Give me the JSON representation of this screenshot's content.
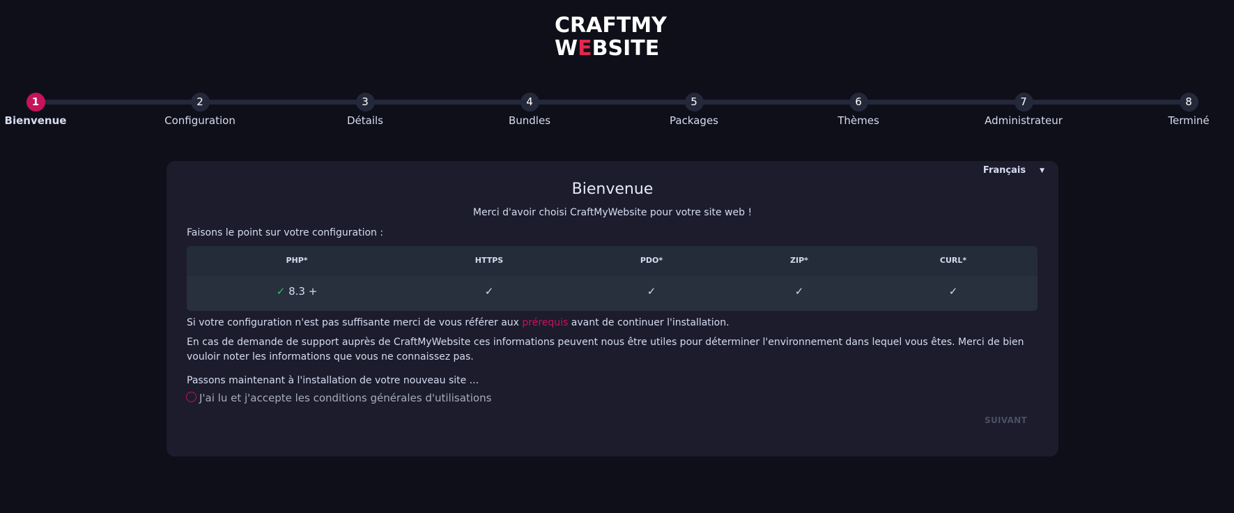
{
  "logo": {
    "line1": "CRAFTMY",
    "line2_before": "W",
    "line2_accent": "E",
    "line2_after": "BSITE"
  },
  "colors": {
    "accent": "#c6135b",
    "logo_accent": "#e3284c",
    "check": "#27c76f",
    "background": "#0f0f19",
    "card": "#1c1c2c"
  },
  "stepper": {
    "active_step": 1,
    "steps": [
      {
        "number": "1",
        "label": "Bienvenue"
      },
      {
        "number": "2",
        "label": "Configuration"
      },
      {
        "number": "3",
        "label": "Détails"
      },
      {
        "number": "4",
        "label": "Bundles"
      },
      {
        "number": "5",
        "label": "Packages"
      },
      {
        "number": "6",
        "label": "Thèmes"
      },
      {
        "number": "7",
        "label": "Administrateur"
      },
      {
        "number": "8",
        "label": "Terminé"
      }
    ]
  },
  "language": {
    "selected": "Français",
    "icon": "caret-down-icon"
  },
  "card": {
    "title": "Bienvenue",
    "subtitle": "Merci d'avoir choisi CraftMyWebsite pour votre site web !",
    "intro": "Faisons le point sur votre configuration :",
    "requirements": {
      "headers": [
        "PHP*",
        "HTTPS",
        "PDO*",
        "ZIP*",
        "CURL*"
      ],
      "php_version": "8.3 +",
      "status_icon": "check-icon"
    },
    "prereq_before": "Si votre configuration n'est pas suffisante merci de vous référer aux ",
    "prereq_link": "prérequis",
    "prereq_after": " avant de continuer l'installation.",
    "support_text": "En cas de demande de support auprès de CraftMyWebsite ces informations peuvent nous être utiles pour déterminer l'environnement dans lequel vous êtes. Merci de bien vouloir noter les informations que vous ne connaissez pas.",
    "next_step_text": "Passons maintenant à l'installation de votre nouveau site ...",
    "terms_label": "J'ai lu et j'accepte les conditions générales d'utilisations",
    "terms_checked": false,
    "next_button": "SUIVANT"
  }
}
